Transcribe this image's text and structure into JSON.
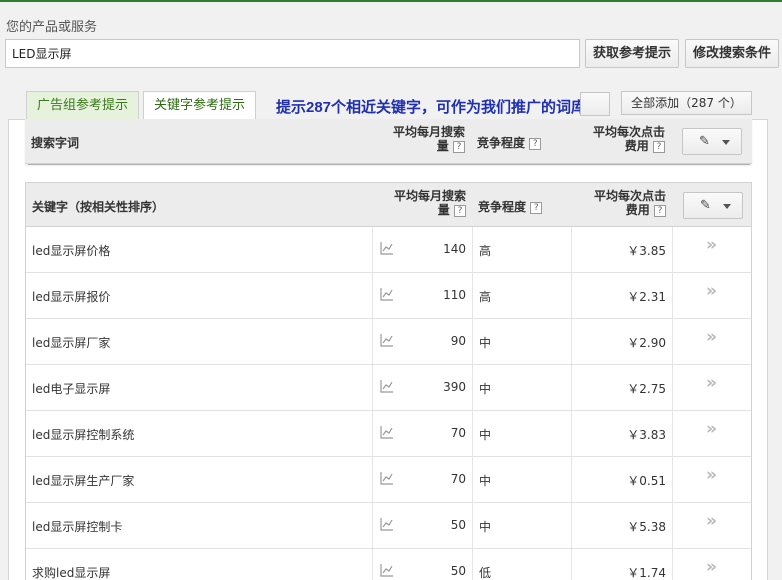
{
  "search": {
    "label": "您的产品或服务",
    "value": "LED显示屏",
    "get_ideas_button": "获取参考提示",
    "modify_search_button": "修改搜索条件"
  },
  "tabs": [
    {
      "label": "广告组参考提示"
    },
    {
      "label": "关键字参考提示"
    }
  ],
  "annotation": "提示287个相近关键字，可作为我们推广的词库",
  "add_all_button": "全部添加（287 个）",
  "sticky_header": {
    "keyword": "搜索字词",
    "volume_line1": "平均每月搜索",
    "volume_line2": "量",
    "competition": "竞争程度",
    "cpc_line1": "平均每次点击",
    "cpc_line2": "费用",
    "help": "?"
  },
  "table_header": {
    "keyword": "关键字（按相关性排序）",
    "volume_line1": "平均每月搜索",
    "volume_line2": "量",
    "competition": "竞争程度",
    "cpc_line1": "平均每次点击",
    "cpc_line2": "费用",
    "help": "?"
  },
  "icons": {
    "trend": "trend-chart-icon",
    "add": "double-chevron-right-icon",
    "edit": "pencil-icon"
  },
  "rows": [
    {
      "keyword": "led显示屏价格",
      "volume": "140",
      "competition": "高",
      "cpc": "￥3.85",
      "add": "»"
    },
    {
      "keyword": "led显示屏报价",
      "volume": "110",
      "competition": "高",
      "cpc": "￥2.31",
      "add": "»"
    },
    {
      "keyword": "led显示屏厂家",
      "volume": "90",
      "competition": "中",
      "cpc": "￥2.90",
      "add": "»"
    },
    {
      "keyword": "led电子显示屏",
      "volume": "390",
      "competition": "中",
      "cpc": "￥2.75",
      "add": "»"
    },
    {
      "keyword": "led显示屏控制系统",
      "volume": "70",
      "competition": "中",
      "cpc": "￥3.83",
      "add": "»"
    },
    {
      "keyword": "led显示屏生产厂家",
      "volume": "70",
      "competition": "中",
      "cpc": "￥0.51",
      "add": "»"
    },
    {
      "keyword": "led显示屏控制卡",
      "volume": "50",
      "competition": "中",
      "cpc": "￥5.38",
      "add": "»"
    },
    {
      "keyword": "求购led显示屏",
      "volume": "50",
      "competition": "低",
      "cpc": "￥1.74",
      "add": "»"
    }
  ]
}
